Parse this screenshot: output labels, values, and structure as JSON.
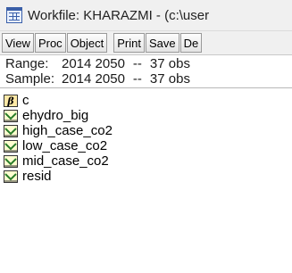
{
  "window": {
    "title": "Workfile: KHARAZMI - (c:\\user"
  },
  "toolbar": {
    "buttons": [
      "View",
      "Proc",
      "Object",
      "Print",
      "Save",
      "De"
    ]
  },
  "info": {
    "range_label": "Range:",
    "range_value": "2014 2050",
    "range_sep": "--",
    "range_obs": "37 obs",
    "sample_label": "Sample:",
    "sample_value": "2014 2050",
    "sample_sep": "--",
    "sample_obs": "37 obs"
  },
  "objects": [
    {
      "name": "c",
      "icon": "coefficient-vector-icon"
    },
    {
      "name": "ehydro_big",
      "icon": "series-icon"
    },
    {
      "name": "high_case_co2",
      "icon": "series-icon"
    },
    {
      "name": "low_case_co2",
      "icon": "series-icon"
    },
    {
      "name": "mid_case_co2",
      "icon": "series-icon"
    },
    {
      "name": "resid",
      "icon": "series-icon"
    }
  ],
  "colors": {
    "icon_border": "#333333",
    "series_icon_fill": "#ffffd0",
    "series_line": "#2a7d2a",
    "coef_icon_fill": "#ffe9a6"
  }
}
